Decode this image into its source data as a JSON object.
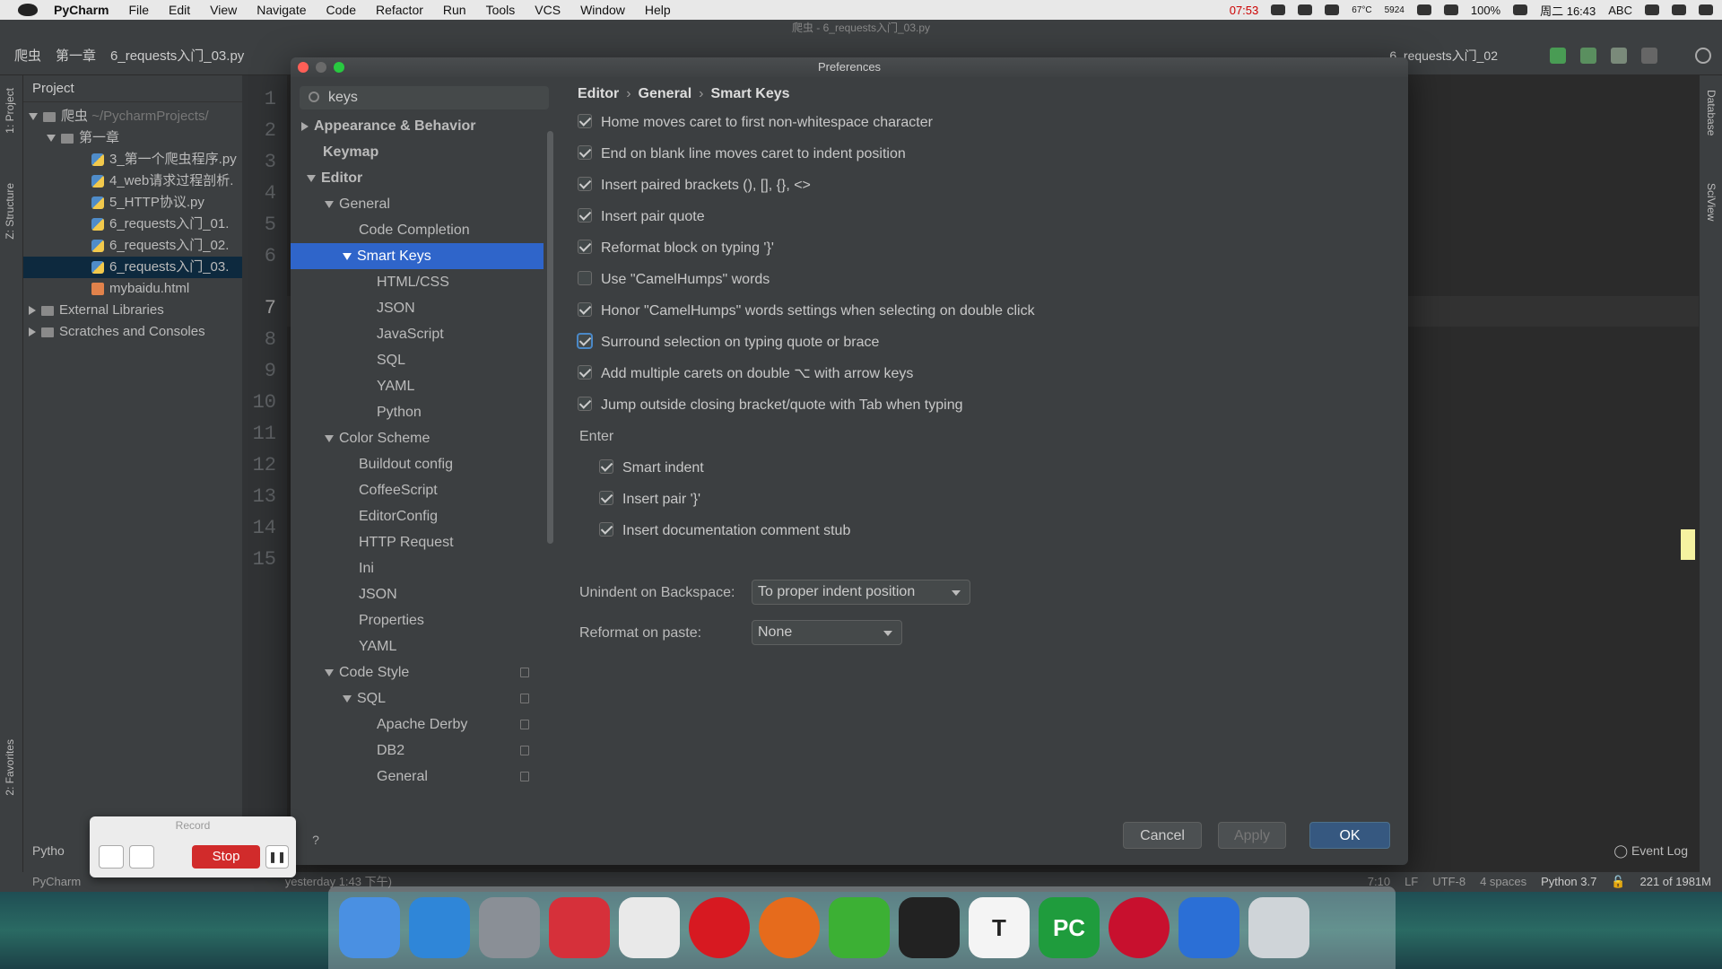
{
  "menubar": {
    "app": "PyCharm",
    "items": [
      "File",
      "Edit",
      "View",
      "Navigate",
      "Code",
      "Refactor",
      "Run",
      "Tools",
      "VCS",
      "Window",
      "Help"
    ],
    "status": {
      "time_left": "07:53",
      "temp": "67°C",
      "rpm": "5924",
      "battery": "100%",
      "clock": "周二 16:43",
      "input": "ABC"
    }
  },
  "ide": {
    "title": "爬虫 - 6_requests入门_03.py",
    "crumbs": [
      "爬虫",
      "第一章",
      "6_requests入门_03.py"
    ],
    "run_config": "6_requests入门_02"
  },
  "stripes": {
    "project": "1: Project",
    "structure": "Z: Structure",
    "favorites": "2: Favorites",
    "database": "Database",
    "sciview": "SciView"
  },
  "project": {
    "header": "Project",
    "tab": "6",
    "items": [
      {
        "label": "爬虫",
        "hint": "~/PycharmProjects/"
      },
      {
        "label": "第一章"
      },
      {
        "label": "3_第一个爬虫程序.py"
      },
      {
        "label": "4_web请求过程剖析."
      },
      {
        "label": "5_HTTP协议.py"
      },
      {
        "label": "6_requests入门_01."
      },
      {
        "label": "6_requests入门_02."
      },
      {
        "label": "6_requests入门_03."
      },
      {
        "label": "mybaidu.html"
      },
      {
        "label": "External Libraries"
      },
      {
        "label": "Scratches and Consoles"
      }
    ],
    "bottom_tab": "Pytho"
  },
  "line_numbers": [
    "1",
    "2",
    "3",
    "4",
    "5",
    "6",
    "7",
    "8",
    "9",
    "10",
    "11",
    "12",
    "13",
    "14",
    "15"
  ],
  "dialog": {
    "title": "Preferences",
    "search": "keys",
    "tree": [
      "Appearance & Behavior",
      "Keymap",
      "Editor",
      "General",
      "Code Completion",
      "Smart Keys",
      "HTML/CSS",
      "JSON",
      "JavaScript",
      "SQL",
      "YAML",
      "Python",
      "Color Scheme",
      "Buildout config",
      "CoffeeScript",
      "EditorConfig",
      "HTTP Request",
      "Ini",
      "JSON",
      "Properties",
      "YAML",
      "Code Style",
      "SQL",
      "Apache Derby",
      "DB2",
      "General"
    ],
    "breadcrumb": [
      "Editor",
      "General",
      "Smart Keys"
    ],
    "options": [
      "Home moves caret to first non-whitespace character",
      "End on blank line moves caret to indent position",
      "Insert paired brackets (), [], {}, <>",
      "Insert pair quote",
      "Reformat block on typing '}'",
      "Use \"CamelHumps\" words",
      "Honor \"CamelHumps\" words settings when selecting on double click",
      "Surround selection on typing quote or brace",
      "Add multiple carets on double ⌥ with arrow keys",
      "Jump outside closing bracket/quote with Tab when typing"
    ],
    "enter_label": "Enter",
    "enter_options": [
      "Smart indent",
      "Insert pair '}'",
      "Insert documentation comment stub"
    ],
    "unindent_label": "Unindent on Backspace:",
    "unindent_value": "To proper indent position",
    "reformat_label": "Reformat on paste:",
    "reformat_value": "None",
    "cancel": "Cancel",
    "apply": "Apply",
    "ok": "OK",
    "help": "?"
  },
  "record": {
    "title": "Record",
    "stop": "Stop"
  },
  "statusbar": {
    "left": "PyCharm",
    "middle": "yesterday 1:43 下午)",
    "position": "7:10",
    "lf": "LF",
    "encoding": "UTF-8",
    "indent": "4 spaces",
    "interpreter": "Python 3.7",
    "memory": "221 of 1981M",
    "event_log": "Event Log"
  },
  "dock": [
    "finder",
    "safari",
    "launchpad",
    "netease-music",
    "chrome",
    "opera",
    "firefox",
    "wechat",
    "qq",
    "typora",
    "pycharm",
    "video-player",
    "thunder",
    "trash"
  ]
}
